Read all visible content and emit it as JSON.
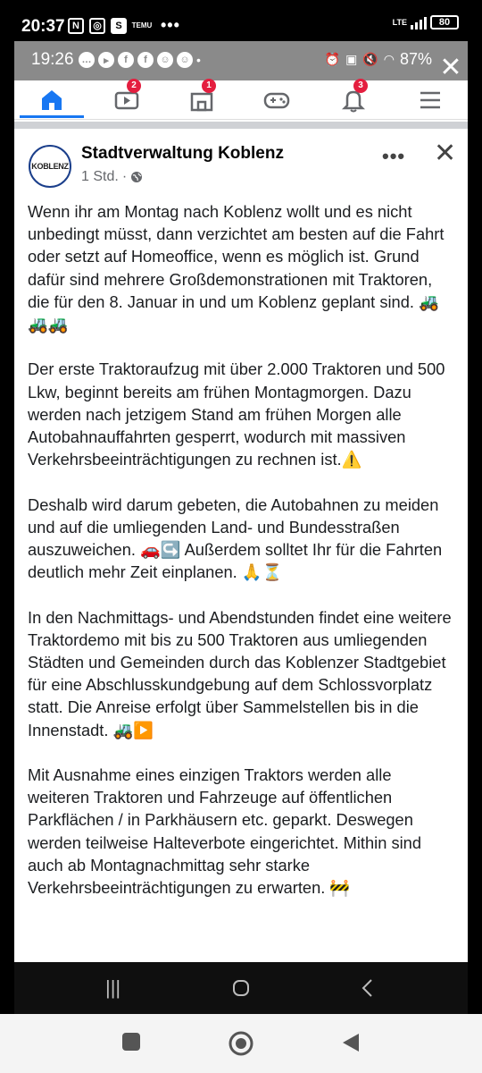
{
  "outer_status": {
    "time": "20:37",
    "app_icons": [
      "N",
      "◎",
      "S",
      "TEMU"
    ],
    "more": "•••",
    "network": "LTE",
    "battery": "80"
  },
  "inner_status": {
    "time": "19:26",
    "battery_percent": "87%"
  },
  "nav": {
    "badges": {
      "video": "2",
      "marketplace": "1",
      "notifications": "3"
    }
  },
  "post": {
    "avatar_text": "KOBLENZ",
    "page_name": "Stadtverwaltung Koblenz",
    "time": "1 Std.",
    "separator": "·",
    "paragraphs": [
      "Wenn ihr am Montag nach Koblenz wollt und es nicht unbedingt müsst, dann verzichtet am besten auf die Fahrt oder setzt auf Homeoffice, wenn es möglich ist. Grund dafür sind mehrere Großdemonstrationen mit Traktoren, die für den 8. Januar in und um Koblenz geplant sind. 🚜🚜🚜",
      "Der erste Traktoraufzug mit über 2.000 Traktoren und 500 Lkw, beginnt bereits am frühen Montagmorgen. Dazu werden nach jetzigem Stand am frühen Morgen alle Autobahnauffahrten gesperrt, wodurch mit massiven Verkehrsbeeinträchtigungen zu rechnen ist.⚠️",
      "Deshalb wird darum gebeten, die Autobahnen zu meiden und auf die umliegenden Land- und Bundesstraßen auszuweichen. 🚗↪️ Außerdem solltet Ihr für die Fahrten deutlich mehr Zeit einplanen. 🙏⏳",
      "In den Nachmittags- und Abendstunden findet eine weitere Traktordemo mit bis zu 500 Traktoren aus umliegenden Städten und Gemeinden durch das Koblenzer Stadtgebiet für eine Abschlusskundgebung auf dem Schlossvorplatz statt. Die Anreise erfolgt über Sammelstellen bis in die Innenstadt. 🚜▶️",
      "Mit Ausnahme eines einzigen Traktors werden alle weiteren Traktoren und Fahrzeuge auf öffentlichen Parkflächen / in Parkhäusern etc. geparkt. Deswegen werden teilweise Halteverbote eingerichtet. Mithin sind auch ab Montagnachmittag sehr starke Verkehrsbeeinträchtigungen zu erwarten. 🚧"
    ]
  },
  "icons": {
    "home": "home-icon",
    "video": "video-icon",
    "marketplace": "marketplace-icon",
    "gaming": "gaming-icon",
    "notifications": "bell-icon",
    "menu": "menu-icon",
    "more": "more-options-icon",
    "close": "close-icon",
    "globe": "globe-icon"
  },
  "colors": {
    "accent": "#1877f2",
    "badge": "#e41e3f",
    "text": "#1c1e21",
    "muted": "#65676b"
  }
}
